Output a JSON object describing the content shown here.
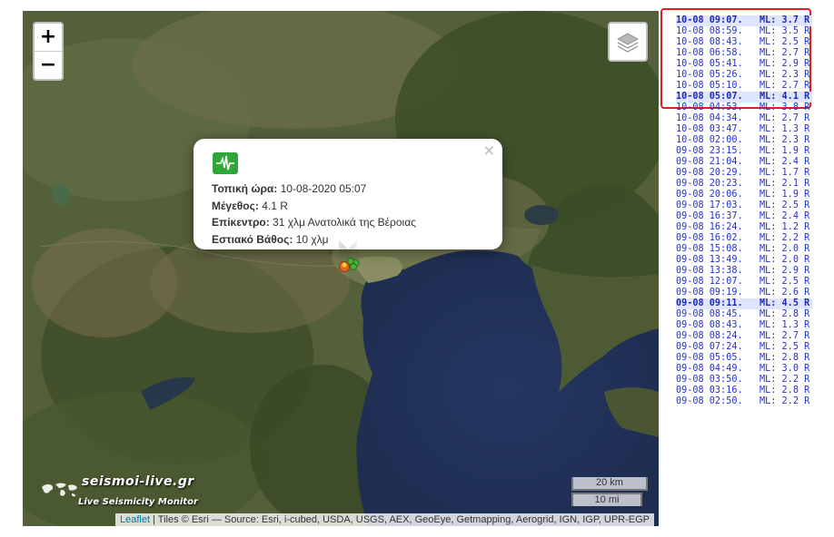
{
  "map": {
    "zoom_in_label": "+",
    "zoom_out_label": "−",
    "popup": {
      "close_label": "×",
      "rows": [
        {
          "label": "Τοπική ώρα:",
          "value": "10-08-2020 05:07"
        },
        {
          "label": "Μέγεθος:",
          "value": "4.1 R"
        },
        {
          "label": "Επίκεντρο:",
          "value": "31 χλμ Ανατολικά της Βέροιας"
        },
        {
          "label": "Εστιακό Βάθος:",
          "value": "10 χλμ"
        }
      ]
    },
    "brand": "seismoi-live.gr",
    "brand_sub": "Live Seismicity Monitor",
    "scale_km": "20 km",
    "scale_mi": "10 mi",
    "attribution_link": "Leaflet",
    "attribution_text": " | Tiles © Esri — Source: Esri, i-cubed, USDA, USGS, AEX, GeoEye, Getmapping, Aerogrid, IGN, IGP, UPR-EGP"
  },
  "quakes": [
    {
      "time": "10-08 09:07.",
      "mag": "ML: 3.7 R"
    },
    {
      "time": "10-08 08:59.",
      "mag": "ML: 3.5 R"
    },
    {
      "time": "10-08 08:43.",
      "mag": "ML: 2.5 R"
    },
    {
      "time": "10-08 06:58.",
      "mag": "ML: 2.7 R"
    },
    {
      "time": "10-08 05:41.",
      "mag": "ML: 2.9 R"
    },
    {
      "time": "10-08 05:26.",
      "mag": "ML: 2.3 R"
    },
    {
      "time": "10-08 05:10.",
      "mag": "ML: 2.7 R"
    },
    {
      "time": "10-08 05:07.",
      "mag": "ML: 4.1 R"
    },
    {
      "time": "10-08 04:53.",
      "mag": "ML: 3.8 R"
    },
    {
      "time": "10-08 04:34.",
      "mag": "ML: 2.7 R"
    },
    {
      "time": "10-08 03:47.",
      "mag": "ML: 1.3 R"
    },
    {
      "time": "10-08 02:00.",
      "mag": "ML: 2.3 R"
    },
    {
      "time": "09-08 23:15.",
      "mag": "ML: 1.9 R"
    },
    {
      "time": "09-08 21:04.",
      "mag": "ML: 2.4 R"
    },
    {
      "time": "09-08 20:29.",
      "mag": "ML: 1.7 R"
    },
    {
      "time": "09-08 20:23.",
      "mag": "ML: 2.1 R"
    },
    {
      "time": "09-08 20:06.",
      "mag": "ML: 1.9 R"
    },
    {
      "time": "09-08 17:03.",
      "mag": "ML: 2.5 R"
    },
    {
      "time": "09-08 16:37.",
      "mag": "ML: 2.4 R"
    },
    {
      "time": "09-08 16:24.",
      "mag": "ML: 1.2 R"
    },
    {
      "time": "09-08 16:02.",
      "mag": "ML: 2.2 R"
    },
    {
      "time": "09-08 15:08.",
      "mag": "ML: 2.0 R"
    },
    {
      "time": "09-08 13:49.",
      "mag": "ML: 2.0 R"
    },
    {
      "time": "09-08 13:38.",
      "mag": "ML: 2.9 R"
    },
    {
      "time": "09-08 12:07.",
      "mag": "ML: 2.5 R"
    },
    {
      "time": "09-08 09:19.",
      "mag": "ML: 2.6 R"
    },
    {
      "time": "09-08 09:11.",
      "mag": "ML: 4.5 R"
    },
    {
      "time": "09-08 08:45.",
      "mag": "ML: 2.8 R"
    },
    {
      "time": "09-08 08:43.",
      "mag": "ML: 1.3 R"
    },
    {
      "time": "09-08 08:24.",
      "mag": "ML: 2.7 R"
    },
    {
      "time": "09-08 07:24.",
      "mag": "ML: 2.5 R"
    },
    {
      "time": "09-08 05:05.",
      "mag": "ML: 2.8 R"
    },
    {
      "time": "09-08 04:49.",
      "mag": "ML: 3.0 R"
    },
    {
      "time": "09-08 03:50.",
      "mag": "ML: 2.2 R"
    },
    {
      "time": "09-08 03:16.",
      "mag": "ML: 2.8 R"
    },
    {
      "time": "09-08 02:50.",
      "mag": "ML: 2.2 R"
    }
  ],
  "colors": {
    "accent": "#2233cc",
    "highlight_bg": "#dfe4ff",
    "annotation": "#e02020",
    "sea": "#23345a",
    "land": "#4d5a33"
  }
}
